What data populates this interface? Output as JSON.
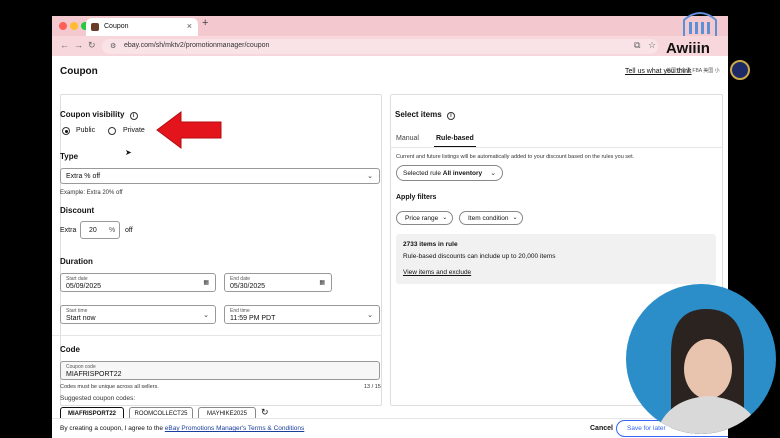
{
  "browser": {
    "tab_title": "Coupon",
    "tab_close": "×",
    "new_tab": "+",
    "url": "ebay.com/sh/mktv2/promotionmanager/coupon"
  },
  "overlay": {
    "logo_text": "Awiiin",
    "logo_subtext": "美国亚马逊 FBA 美国 小"
  },
  "page": {
    "title": "Coupon",
    "top_link": "Tell us what you think",
    "visibility": {
      "heading": "Coupon visibility",
      "options": [
        "Public",
        "Private"
      ],
      "selected": "Public"
    },
    "type": {
      "heading": "Type",
      "value": "Extra % off",
      "example": "Example: Extra 20% off"
    },
    "discount": {
      "heading": "Discount",
      "prefix": "Extra",
      "value": "20",
      "unit": "%",
      "suffix": "off"
    },
    "duration": {
      "heading": "Duration",
      "start_date_label": "Start date",
      "start_date": "05/09/2025",
      "end_date_label": "End date",
      "end_date": "05/30/2025",
      "start_time_label": "Start time",
      "start_time": "Start now",
      "end_time_label": "End time",
      "end_time": "11:59 PM PDT"
    },
    "code": {
      "heading": "Code",
      "field_label": "Coupon code",
      "value": "MIAFRISPORT22",
      "hint": "Codes must be unique across all sellers.",
      "counter": "13 / 15",
      "suggested_label": "Suggested coupon codes:",
      "suggestions": [
        "MIAFRISPORT22",
        "ROOMCOLLECT25",
        "MAYHIKE2025"
      ]
    },
    "select_items": {
      "heading": "Select items",
      "tabs": [
        "Manual",
        "Rule-based"
      ],
      "active_tab": "Rule-based",
      "description": "Current and future listings will be automatically added to your discount based on the rules you set.",
      "selected_rule_label": "Selected rule",
      "selected_rule_value": "All inventory",
      "filters_heading": "Apply filters",
      "filters": [
        "Price range",
        "Item condition"
      ],
      "items_count": "2733 items in rule",
      "items_note": "Rule-based discounts can include up to 20,000 items",
      "items_link": "View items and exclude"
    },
    "footer": {
      "agree_text": "By creating a coupon, I agree to the ",
      "agree_link": "eBay Promotions Manager's Terms & Conditions",
      "cancel": "Cancel",
      "save": "Save for later"
    }
  },
  "colors": {
    "tab_strip": "#f4c8cf",
    "arrow": "#e3141b",
    "link": "#1a3d9e",
    "circle": "#2b8ec9"
  }
}
